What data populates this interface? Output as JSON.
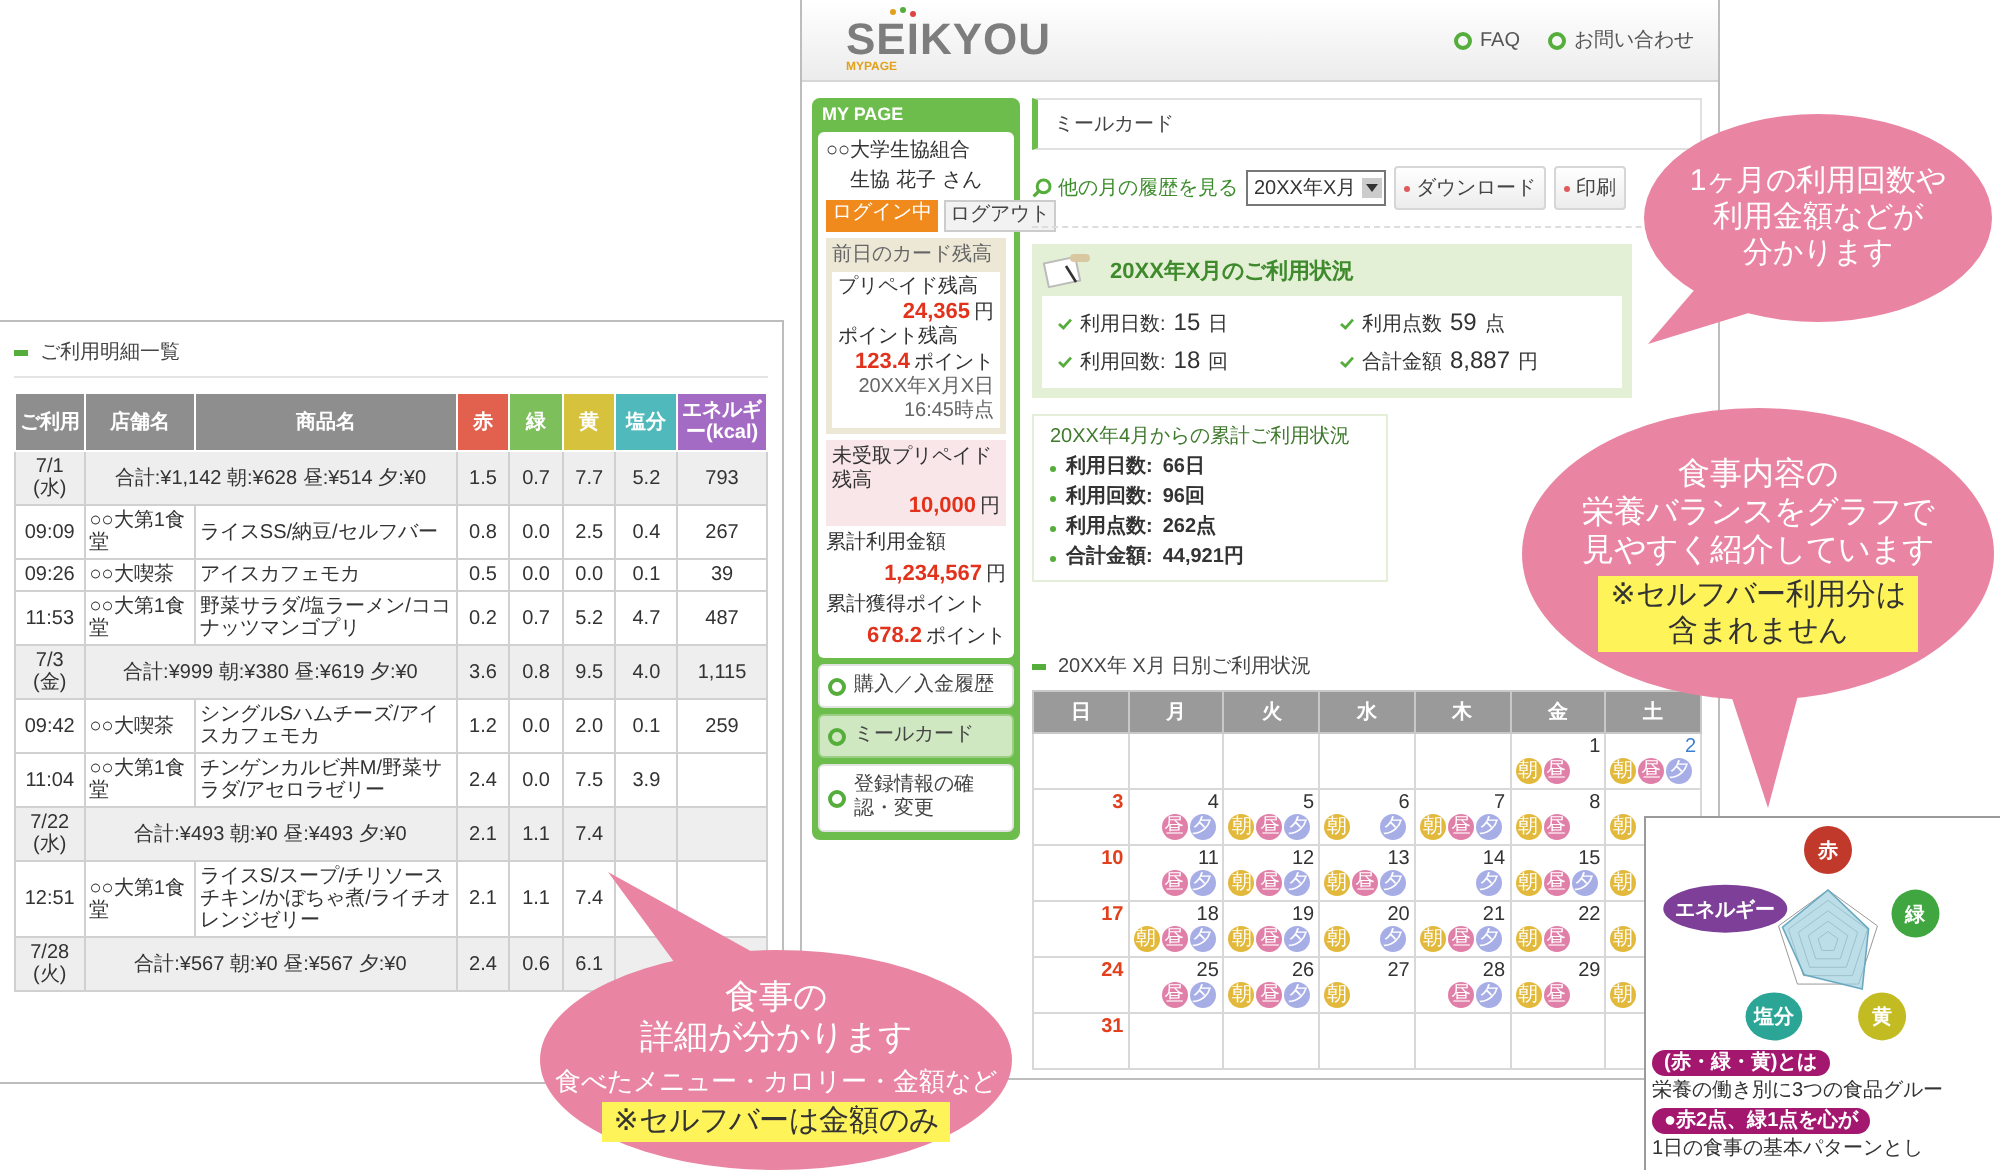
{
  "details_panel": {
    "title": "ご利用明細一覧",
    "columns": [
      {
        "label": "ご利用",
        "color": "#8e8e8e"
      },
      {
        "label": "店舗名",
        "color": "#8e8e8e"
      },
      {
        "label": "商品名",
        "color": "#8e8e8e"
      },
      {
        "label": "赤",
        "color": "#e2604e"
      },
      {
        "label": "緑",
        "color": "#7dbf5b"
      },
      {
        "label": "黄",
        "color": "#d6c23c"
      },
      {
        "label": "塩分",
        "color": "#50b9bb"
      },
      {
        "label": "エネルギー(kcal)",
        "color": "#a46bc4"
      }
    ],
    "rows": [
      {
        "kind": "summary",
        "date": "7/1",
        "weekday": "(水)",
        "text": "合計:¥1,142 朝:¥628 昼:¥514 夕:¥0",
        "values": [
          "1.5",
          "0.7",
          "7.7",
          "5.2",
          "793"
        ]
      },
      {
        "kind": "item",
        "time": "09:09",
        "store": "○○大第1食堂",
        "items": "ライスSS/納豆/セルフバー",
        "values": [
          "0.8",
          "0.0",
          "2.5",
          "0.4",
          "267"
        ]
      },
      {
        "kind": "item",
        "time": "09:26",
        "store": "○○大喫茶",
        "items": "アイスカフェモカ",
        "values": [
          "0.5",
          "0.0",
          "0.0",
          "0.1",
          "39"
        ]
      },
      {
        "kind": "item",
        "time": "11:53",
        "store": "○○大第1食堂",
        "items": "野菜サラダ/塩ラーメン/ココナッツマンゴプリ",
        "values": [
          "0.2",
          "0.7",
          "5.2",
          "4.7",
          "487"
        ]
      },
      {
        "kind": "summary",
        "date": "7/3",
        "weekday": "(金)",
        "text": "合計:¥999 朝:¥380 昼:¥619 夕:¥0",
        "values": [
          "3.6",
          "0.8",
          "9.5",
          "4.0",
          "1,115"
        ]
      },
      {
        "kind": "item",
        "time": "09:42",
        "store": "○○大喫茶",
        "items": "シングルSハムチーズ/アイスカフェモカ",
        "values": [
          "1.2",
          "0.0",
          "2.0",
          "0.1",
          "259"
        ]
      },
      {
        "kind": "item",
        "time": "11:04",
        "store": "○○大第1食堂",
        "items": "チンゲンカルビ丼M/野菜サラダ/アセロラゼリー",
        "values": [
          "2.4",
          "0.0",
          "7.5",
          "3.9"
        ]
      },
      {
        "kind": "summary",
        "date": "7/22",
        "weekday": "(水)",
        "text": "合計:¥493 朝:¥0 昼:¥493 夕:¥0",
        "values": [
          "2.1",
          "1.1",
          "7.4"
        ]
      },
      {
        "kind": "item",
        "time": "12:51",
        "store": "○○大第1食堂",
        "items": "ライスS/スープ/チリソースチキン/かぼちゃ煮/ライチオレンジゼリー",
        "values": [
          "2.1",
          "1.1",
          "7.4"
        ]
      },
      {
        "kind": "summary",
        "date": "7/28",
        "weekday": "(火)",
        "text": "合計:¥567 朝:¥0 昼:¥567 夕:¥0",
        "values": [
          "2.4",
          "0.6",
          "6.1"
        ]
      }
    ]
  },
  "page": {
    "logo": {
      "name": "SEIKYOU",
      "sub": "MYPAGE"
    },
    "header_links": [
      "FAQ",
      "お問い合わせ"
    ],
    "sidebar": {
      "title": "MY PAGE",
      "org": "○○大学生協組合",
      "user": "生協 花子",
      "honorific": "さん",
      "login_status": "ログイン中",
      "logout": "ログアウト",
      "balance_title": "前日のカード残高",
      "balances": [
        {
          "label": "プリペイド残高",
          "value": "24,365",
          "unit": "円"
        },
        {
          "label": "ポイント残高",
          "value": "123.4",
          "unit": "ポイント"
        }
      ],
      "as_of": "20XX年X月X日 16:45時点",
      "pending": {
        "label": "未受取プリペイド残高",
        "value": "10,000",
        "unit": "円"
      },
      "totals": [
        {
          "label": "累計利用金額",
          "value": "1,234,567",
          "unit": "円"
        },
        {
          "label": "累計獲得ポイント",
          "value": "678.2",
          "unit": "ポイント"
        }
      ],
      "menu": [
        {
          "label": "購入／入金履歴",
          "selected": false
        },
        {
          "label": "ミールカード",
          "selected": true
        },
        {
          "label": "登録情報の確認・変更",
          "selected": false
        }
      ]
    },
    "title": "ミールカード",
    "history_link": "他の月の履歴を見る",
    "month_select": "20XX年X月",
    "buttons": [
      "ダウンロード",
      "印刷"
    ],
    "monthly": {
      "title": "20XX年X月のご利用状況",
      "stats": [
        {
          "label": "利用日数:",
          "value": "15",
          "unit": "日"
        },
        {
          "label": "利用点数",
          "value": "59",
          "unit": "点"
        },
        {
          "label": "利用回数:",
          "value": "18",
          "unit": "回"
        },
        {
          "label": "合計金額",
          "value": "8,887",
          "unit": "円"
        }
      ]
    },
    "cumulative": {
      "title": "20XX年4月からの累計ご利用状況",
      "items": [
        {
          "label": "利用日数:",
          "value": "66日"
        },
        {
          "label": "利用回数:",
          "value": "96回"
        },
        {
          "label": "利用点数:",
          "value": "262点"
        },
        {
          "label": "合計金額:",
          "value": "44,921円"
        }
      ]
    },
    "calendar": {
      "title": "20XX年 X月 日別ご利用状況",
      "weekdays": [
        "日",
        "月",
        "火",
        "水",
        "木",
        "金",
        "土"
      ],
      "weeks": [
        [
          {
            "day": "1",
            "meals": [
              {
                "kind": "breakfast",
                "label": "朝"
              },
              {
                "kind": "lunch",
                "label": "昼"
              }
            ]
          },
          {
            "day": "2",
            "meals": [
              {
                "kind": "breakfast",
                "label": "朝"
              },
              {
                "kind": "lunch",
                "label": "昼"
              },
              {
                "kind": "dinner",
                "label": "夕"
              }
            ]
          }
        ],
        [
          {
            "day": "3"
          },
          {
            "day": "4",
            "meals": [
              {
                "kind": "lunch",
                "label": "昼"
              },
              {
                "kind": "dinner",
                "label": "夕"
              }
            ]
          },
          {
            "day": "5",
            "meals": [
              {
                "kind": "breakfast",
                "label": "朝"
              },
              {
                "kind": "lunch",
                "label": "昼"
              },
              {
                "kind": "dinner",
                "label": "夕"
              }
            ]
          },
          {
            "day": "6",
            "meals": [
              {
                "kind": "breakfast",
                "label": "朝"
              },
              {
                "kind": "dinner",
                "label": "夕"
              }
            ]
          },
          {
            "day": "7",
            "meals": [
              {
                "kind": "breakfast",
                "label": "朝"
              },
              {
                "kind": "lunch",
                "label": "昼"
              },
              {
                "kind": "dinner",
                "label": "夕"
              }
            ]
          },
          {
            "day": "8",
            "meals": [
              {
                "kind": "breakfast",
                "label": "朝"
              },
              {
                "kind": "lunch",
                "label": "昼"
              }
            ]
          },
          {
            "meals": [
              {
                "kind": "breakfast",
                "label": "朝"
              }
            ]
          }
        ],
        [
          {
            "day": "10"
          },
          {
            "day": "11",
            "meals": [
              {
                "kind": "lunch",
                "label": "昼"
              },
              {
                "kind": "dinner",
                "label": "夕"
              }
            ]
          },
          {
            "day": "12",
            "meals": [
              {
                "kind": "breakfast",
                "label": "朝"
              },
              {
                "kind": "lunch",
                "label": "昼"
              },
              {
                "kind": "dinner",
                "label": "夕"
              }
            ]
          },
          {
            "day": "13",
            "meals": [
              {
                "kind": "breakfast",
                "label": "朝"
              },
              {
                "kind": "lunch",
                "label": "昼"
              },
              {
                "kind": "dinner",
                "label": "夕"
              }
            ]
          },
          {
            "day": "14",
            "meals": [
              {
                "kind": "dinner",
                "label": "夕"
              }
            ]
          },
          {
            "day": "15",
            "meals": [
              {
                "kind": "breakfast",
                "label": "朝"
              },
              {
                "kind": "lunch",
                "label": "昼"
              },
              {
                "kind": "dinner",
                "label": "夕"
              }
            ]
          },
          {
            "meals": [
              {
                "kind": "breakfast",
                "label": "朝"
              }
            ]
          }
        ],
        [
          {
            "day": "17"
          },
          {
            "day": "18",
            "meals": [
              {
                "kind": "breakfast",
                "label": "朝"
              },
              {
                "kind": "lunch",
                "label": "昼"
              },
              {
                "kind": "dinner",
                "label": "夕"
              }
            ]
          },
          {
            "day": "19",
            "meals": [
              {
                "kind": "breakfast",
                "label": "朝"
              },
              {
                "kind": "lunch",
                "label": "昼"
              },
              {
                "kind": "dinner",
                "label": "夕"
              }
            ]
          },
          {
            "day": "20",
            "meals": [
              {
                "kind": "breakfast",
                "label": "朝"
              },
              {
                "kind": "dinner",
                "label": "夕"
              }
            ]
          },
          {
            "day": "21",
            "meals": [
              {
                "kind": "breakfast",
                "label": "朝"
              },
              {
                "kind": "lunch",
                "label": "昼"
              },
              {
                "kind": "dinner",
                "label": "夕"
              }
            ]
          },
          {
            "day": "22",
            "meals": [
              {
                "kind": "breakfast",
                "label": "朝"
              },
              {
                "kind": "lunch",
                "label": "昼"
              }
            ]
          },
          {
            "meals": [
              {
                "kind": "breakfast",
                "label": "朝"
              }
            ]
          }
        ],
        [
          {
            "day": "24"
          },
          {
            "day": "25",
            "meals": [
              {
                "kind": "lunch",
                "label": "昼"
              },
              {
                "kind": "dinner",
                "label": "夕"
              }
            ]
          },
          {
            "day": "26",
            "meals": [
              {
                "kind": "breakfast",
                "label": "朝"
              },
              {
                "kind": "lunch",
                "label": "昼"
              },
              {
                "kind": "dinner",
                "label": "夕"
              }
            ]
          },
          {
            "day": "27",
            "meals": [
              {
                "kind": "breakfast",
                "label": "朝"
              }
            ]
          },
          {
            "day": "28",
            "meals": [
              {
                "kind": "lunch",
                "label": "昼"
              },
              {
                "kind": "dinner",
                "label": "夕"
              }
            ]
          },
          {
            "day": "29",
            "meals": [
              {
                "kind": "breakfast",
                "label": "朝"
              },
              {
                "kind": "lunch",
                "label": "昼"
              }
            ]
          },
          {
            "meals": [
              {
                "kind": "breakfast",
                "label": "朝"
              }
            ]
          }
        ],
        [
          {
            "day": "31"
          }
        ]
      ]
    }
  },
  "radar": {
    "nodes": [
      {
        "label": "赤",
        "color": "#c0392b"
      },
      {
        "label": "緑",
        "color": "#3fa640"
      },
      {
        "label": "黄",
        "color": "#c3bb22"
      },
      {
        "label": "塩分",
        "color": "#2aa596"
      },
      {
        "label": "エネルギー",
        "color": "#7e3f98"
      }
    ],
    "notes": [
      {
        "heading": "(赤・緑・黄)とは",
        "text": "栄養の働き別に3つの食品グルー"
      },
      {
        "heading": "●赤2点、緑1点を心が",
        "text": "1日の食事の基本パターンとし"
      }
    ]
  },
  "callouts": [
    {
      "lines": [
        "1ヶ月の利用回数や",
        "利用金額などが",
        "分かります"
      ]
    },
    {
      "lines": [
        "食事内容の",
        "栄養バランスをグラフで",
        "見やすく紹介しています"
      ],
      "note_lines": [
        "※セルフバー利用分は",
        "含まれません"
      ]
    },
    {
      "lines": [
        "食事の",
        "詳細が分かります"
      ],
      "sub": "食べたメニュー・カロリー・金額など",
      "note_lines": [
        "※セルフバーは金額のみ"
      ]
    }
  ]
}
